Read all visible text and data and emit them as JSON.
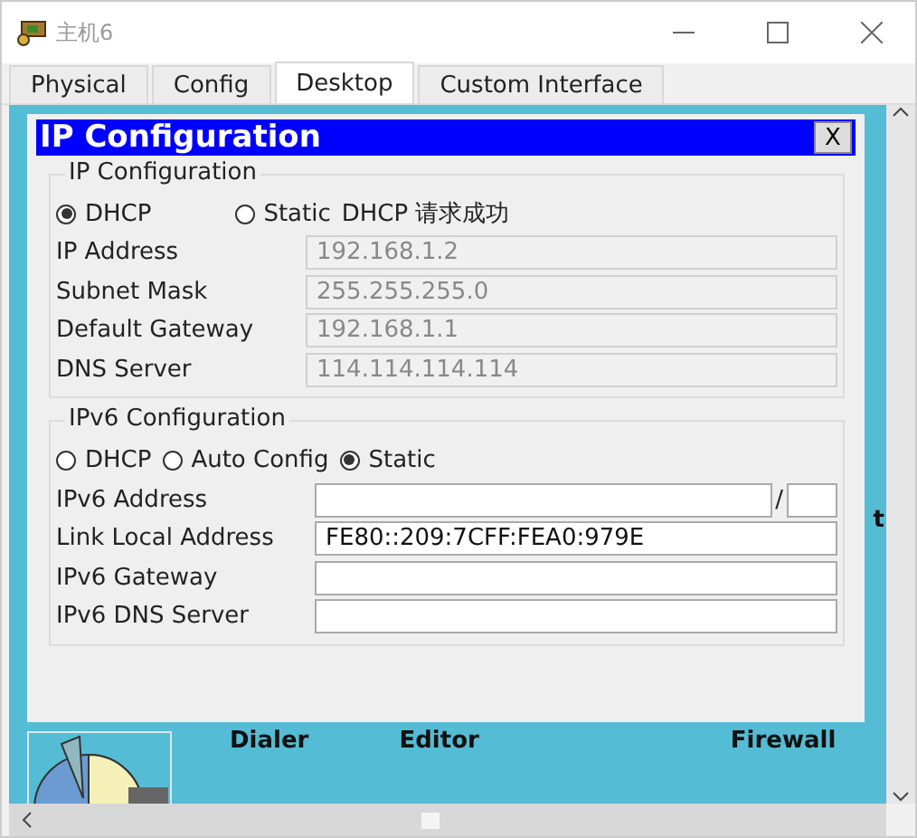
{
  "window": {
    "title": "主机6"
  },
  "tabs": [
    {
      "label": "Physical",
      "selected": false
    },
    {
      "label": "Config",
      "selected": false
    },
    {
      "label": "Desktop",
      "selected": true
    },
    {
      "label": "Custom Interface",
      "selected": false
    }
  ],
  "dialog": {
    "title": "IP Configuration",
    "close": "X",
    "ipv4": {
      "heading": "IP Configuration",
      "status": "DHCP 请求成功",
      "modes": [
        {
          "label": "DHCP",
          "selected": true
        },
        {
          "label": "Static",
          "selected": false
        }
      ],
      "fields": [
        {
          "label": "IP Address",
          "value": "192.168.1.2",
          "disabled": true
        },
        {
          "label": "Subnet Mask",
          "value": "255.255.255.0",
          "disabled": true
        },
        {
          "label": "Default Gateway",
          "value": "192.168.1.1",
          "disabled": true
        },
        {
          "label": "DNS Server",
          "value": "114.114.114.114",
          "disabled": true
        }
      ]
    },
    "ipv6": {
      "heading": "IPv6 Configuration",
      "modes": [
        {
          "label": "DHCP",
          "selected": false
        },
        {
          "label": "Auto Config",
          "selected": false
        },
        {
          "label": "Static",
          "selected": true
        }
      ],
      "fields": [
        {
          "label": "IPv6 Address",
          "kind": "prefixed",
          "separator": "/",
          "disabled": false
        },
        {
          "label": "Link Local Address",
          "kind": "plain",
          "value": "FE80::209:7CFF:FEA0:979E",
          "disabled": false
        },
        {
          "label": "IPv6 Gateway",
          "kind": "plain",
          "disabled": false
        },
        {
          "label": "IPv6 DNS Server",
          "kind": "plain",
          "disabled": false
        }
      ]
    }
  },
  "desktop": {
    "apps": [
      {
        "label": "Dialer"
      },
      {
        "label": "Editor"
      },
      {
        "label": "Firewall"
      }
    ],
    "fragment": "t"
  }
}
